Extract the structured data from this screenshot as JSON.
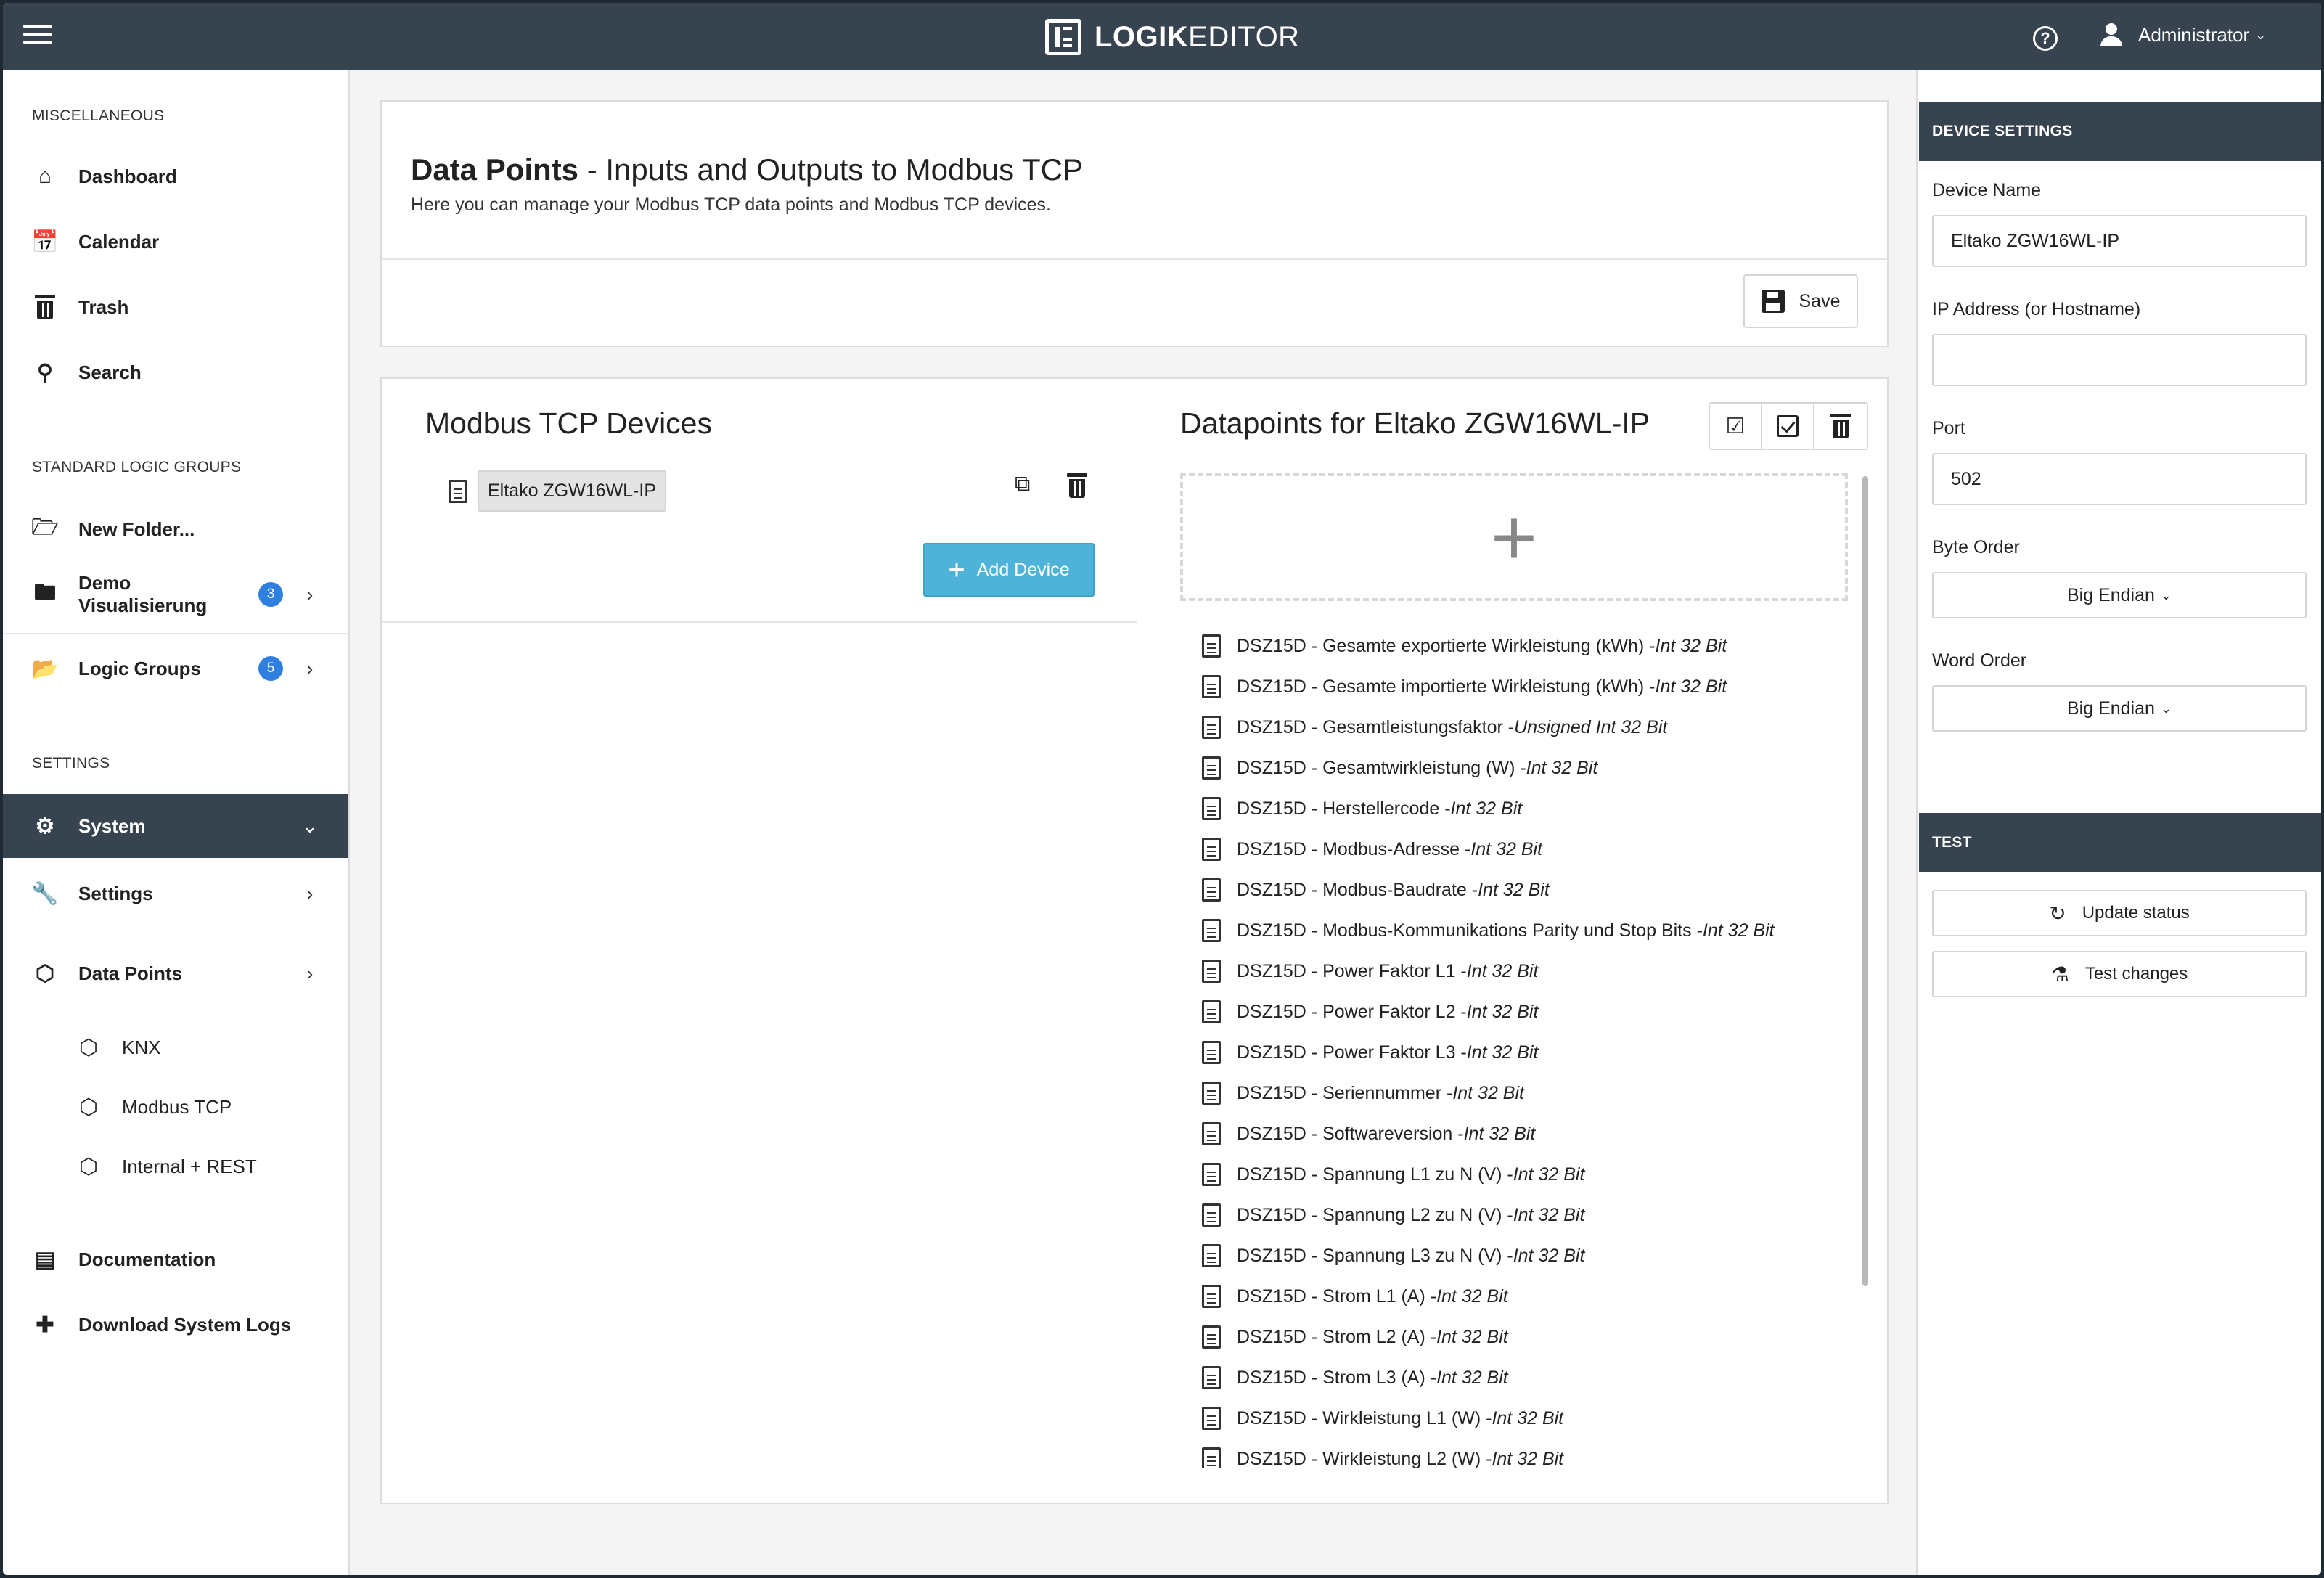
{
  "app": {
    "brand_bold": "LOGIK",
    "brand_light": "EDITOR",
    "user": "Administrator"
  },
  "sidebar": {
    "section_misc": "MISCELLANEOUS",
    "misc_items": [
      {
        "label": "Dashboard",
        "icon": "home-icon"
      },
      {
        "label": "Calendar",
        "icon": "calendar-icon"
      },
      {
        "label": "Trash",
        "icon": "trash-icon"
      },
      {
        "label": "Search",
        "icon": "search-icon"
      }
    ],
    "section_logic": "STANDARD LOGIC GROUPS",
    "logic_items": [
      {
        "label": "New Folder..."
      },
      {
        "label": "Demo Visualisierung",
        "badge": "3"
      },
      {
        "label": "Logic Groups",
        "badge": "5"
      }
    ],
    "section_settings": "SETTINGS",
    "settings_items": [
      {
        "label": "System"
      },
      {
        "label": "Settings"
      },
      {
        "label": "Data Points"
      }
    ],
    "datapoint_subitems": [
      "KNX",
      "Modbus TCP",
      "Internal + REST"
    ],
    "bottom_items": [
      {
        "label": "Documentation"
      },
      {
        "label": "Download System Logs"
      }
    ]
  },
  "header": {
    "title_bold": "Data Points",
    "title_rest": " - Inputs and Outputs to Modbus TCP",
    "description": "Here you can manage your Modbus TCP data points and Modbus TCP devices.",
    "save_label": "Save"
  },
  "devices": {
    "title": "Modbus TCP Devices",
    "items": [
      "Eltako ZGW16WL-IP"
    ],
    "add_label": "Add Device"
  },
  "datapoints": {
    "title": "Datapoints for Eltako ZGW16WL-IP",
    "items": [
      {
        "name": "DSZ15D - Gesamte exportierte Wirkleistung (kWh) - ",
        "type": "Int 32 Bit"
      },
      {
        "name": "DSZ15D - Gesamte importierte Wirkleistung (kWh) - ",
        "type": "Int 32 Bit"
      },
      {
        "name": "DSZ15D - Gesamtleistungsfaktor - ",
        "type": "Unsigned Int 32 Bit"
      },
      {
        "name": "DSZ15D - Gesamtwirkleistung (W) - ",
        "type": "Int 32 Bit"
      },
      {
        "name": "DSZ15D - Herstellercode - ",
        "type": "Int 32 Bit"
      },
      {
        "name": "DSZ15D - Modbus-Adresse - ",
        "type": "Int 32 Bit"
      },
      {
        "name": "DSZ15D - Modbus-Baudrate - ",
        "type": "Int 32 Bit"
      },
      {
        "name": "DSZ15D - Modbus-Kommunikations Parity und Stop Bits - ",
        "type": "Int 32 Bit"
      },
      {
        "name": "DSZ15D - Power Faktor L1 - ",
        "type": "Int 32 Bit"
      },
      {
        "name": "DSZ15D - Power Faktor L2 - ",
        "type": "Int 32 Bit"
      },
      {
        "name": "DSZ15D - Power Faktor L3 - ",
        "type": "Int 32 Bit"
      },
      {
        "name": "DSZ15D - Seriennummer - ",
        "type": "Int 32 Bit"
      },
      {
        "name": "DSZ15D - Softwareversion - ",
        "type": "Int 32 Bit"
      },
      {
        "name": "DSZ15D - Spannung L1 zu N (V) - ",
        "type": "Int 32 Bit"
      },
      {
        "name": "DSZ15D - Spannung L2 zu N (V) - ",
        "type": "Int 32 Bit"
      },
      {
        "name": "DSZ15D - Spannung L3 zu N (V) - ",
        "type": "Int 32 Bit"
      },
      {
        "name": "DSZ15D - Strom L1 (A) - ",
        "type": "Int 32 Bit"
      },
      {
        "name": "DSZ15D - Strom L2 (A) - ",
        "type": "Int 32 Bit"
      },
      {
        "name": "DSZ15D - Strom L3 (A) - ",
        "type": "Int 32 Bit"
      },
      {
        "name": "DSZ15D - Wirkleistung L1 (W) - ",
        "type": "Int 32 Bit"
      },
      {
        "name": "DSZ15D - Wirkleistung L2 (W) - ",
        "type": "Int 32 Bit"
      }
    ]
  },
  "device_settings": {
    "heading": "DEVICE SETTINGS",
    "device_name_label": "Device Name",
    "device_name_value": "Eltako ZGW16WL-IP",
    "ip_label": "IP Address (or Hostname)",
    "ip_value": "",
    "port_label": "Port",
    "port_value": "502",
    "byte_order_label": "Byte Order",
    "byte_order_value": "Big Endian",
    "word_order_label": "Word Order",
    "word_order_value": "Big Endian"
  },
  "test": {
    "heading": "TEST",
    "update_label": "Update status",
    "test_label": "Test changes"
  }
}
